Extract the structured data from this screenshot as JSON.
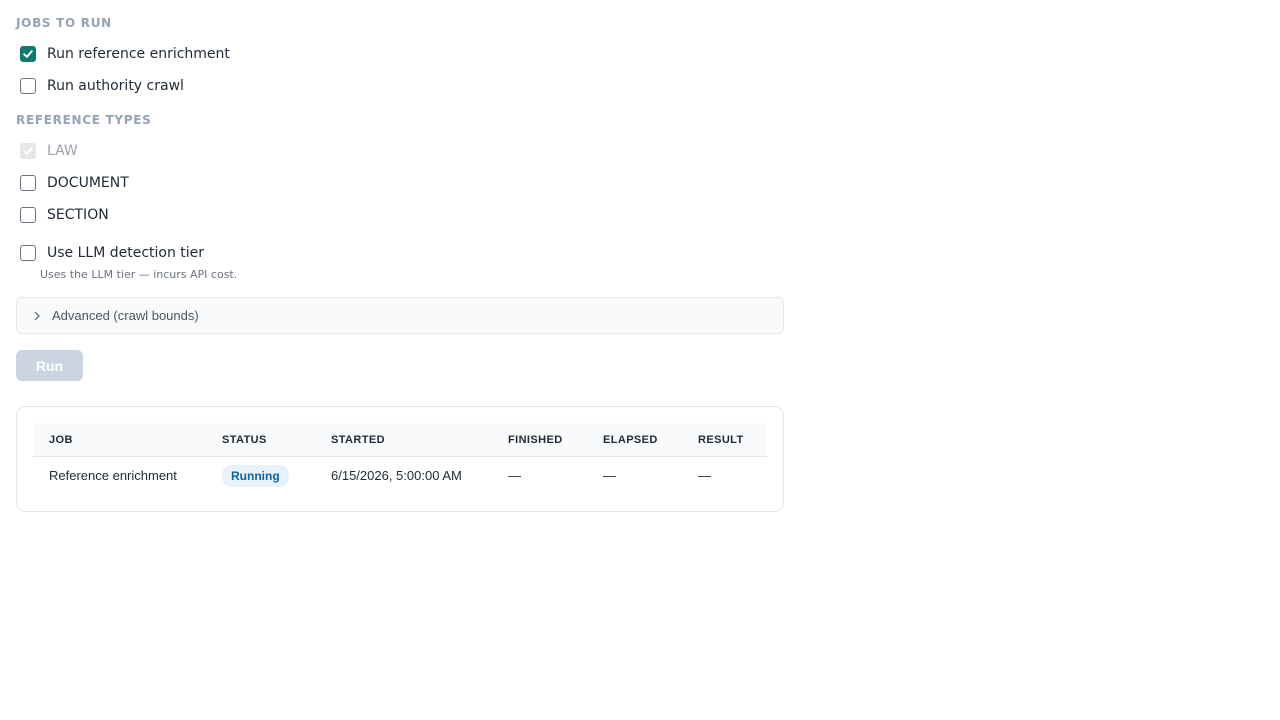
{
  "jobs_section": {
    "title": "JOBS TO RUN",
    "options": [
      {
        "label": "Run reference enrichment",
        "checked": true
      },
      {
        "label": "Run authority crawl",
        "checked": false
      }
    ]
  },
  "reference_types": {
    "title": "REFERENCE TYPES",
    "options": [
      {
        "label": "LAW",
        "checked": true,
        "disabled": true
      },
      {
        "label": "DOCUMENT",
        "checked": false
      },
      {
        "label": "SECTION",
        "checked": false
      }
    ]
  },
  "llm": {
    "label": "Use LLM detection tier",
    "checked": false,
    "hint": "Uses the LLM tier — incurs API cost."
  },
  "advanced": {
    "label": "Advanced (crawl bounds)",
    "expanded": false
  },
  "run_button": {
    "label": "Run",
    "disabled": true
  },
  "jobs_table": {
    "columns": [
      "JOB",
      "STATUS",
      "STARTED",
      "FINISHED",
      "ELAPSED",
      "RESULT"
    ],
    "rows": [
      {
        "job": "Reference enrichment",
        "status": "Running",
        "started": "6/15/2026, 5:00:00 AM",
        "finished": "—",
        "elapsed": "—",
        "result": "—"
      }
    ]
  },
  "colors": {
    "accent": "#0f7b6c",
    "status_running_bg": "#e8f2fb",
    "status_running_text": "#0b63a8",
    "section_title": "#94a3b8"
  },
  "icons": {
    "checkmark": "check-icon",
    "disclosure": "chevron-right-icon"
  }
}
